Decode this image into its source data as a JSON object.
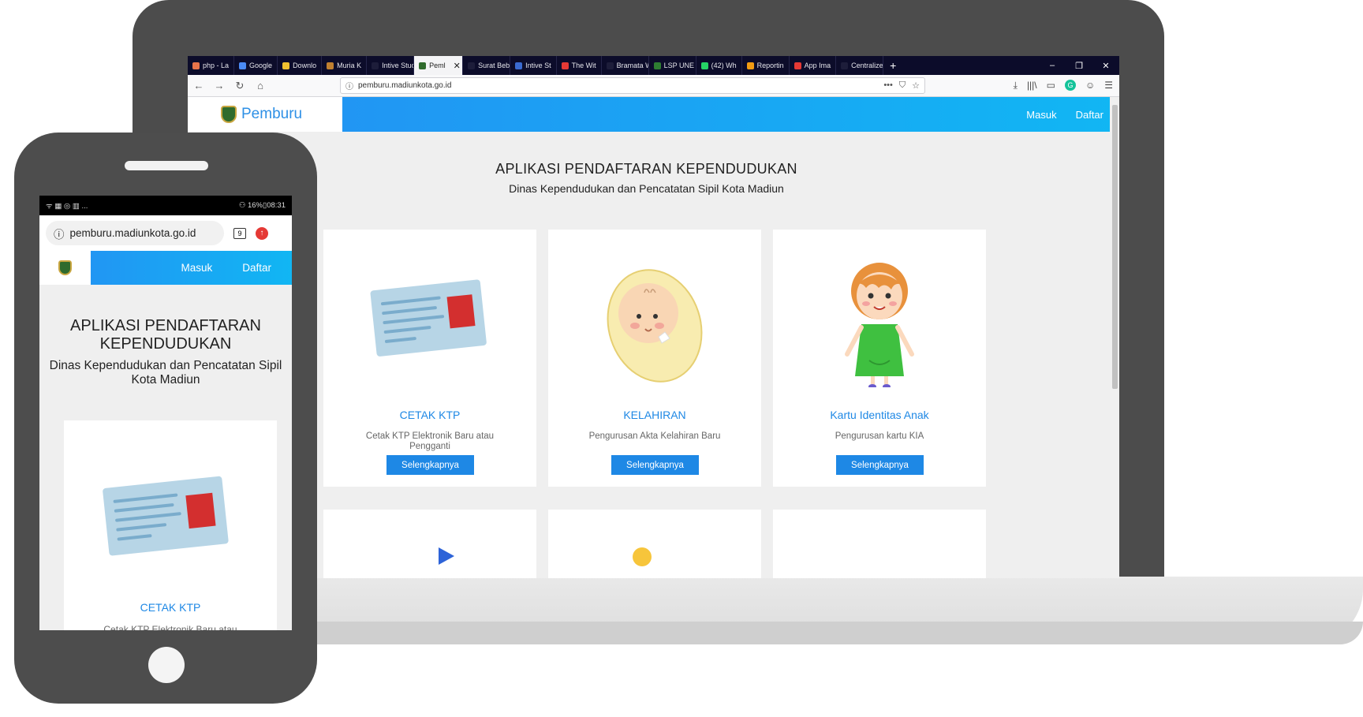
{
  "browser": {
    "tabs": [
      {
        "label": "php - La",
        "color": "#e8744a"
      },
      {
        "label": "Google",
        "color": "#4a8af4"
      },
      {
        "label": "Downlo",
        "color": "#f0c030"
      },
      {
        "label": "Muria K",
        "color": "#c08030"
      },
      {
        "label": "Intive Studio",
        "color": "#1d1d3a"
      },
      {
        "label": "Peml",
        "color": "#2f6b2d",
        "active": true
      },
      {
        "label": "Surat Bebas",
        "color": "#1d1d3a"
      },
      {
        "label": "Intive St",
        "color": "#3a6ad0"
      },
      {
        "label": "The Wit",
        "color": "#e53935"
      },
      {
        "label": "Bramata Wi",
        "color": "#1d1d3a"
      },
      {
        "label": "LSP UNE",
        "color": "#2e7d32"
      },
      {
        "label": "(42) Wh",
        "color": "#25d366"
      },
      {
        "label": "Reportin",
        "color": "#f39c12"
      },
      {
        "label": "App Ima",
        "color": "#e53935"
      },
      {
        "label": "Centralize H",
        "color": "#1d1d3a"
      }
    ],
    "new_tab": "+",
    "window_controls": [
      "–",
      "❐",
      "✕"
    ],
    "url": "pemburu.madiunkota.go.id",
    "url_actions": [
      "•••",
      "⛉",
      "☆"
    ],
    "toolbar_icons": [
      "⤓",
      "|||\\",
      "▭",
      "G",
      "☺",
      "☰"
    ],
    "nav_icons": [
      "←",
      "→",
      "↻",
      "⌂"
    ]
  },
  "site": {
    "brand": "Pemburu",
    "nav": {
      "login": "Masuk",
      "register": "Daftar"
    },
    "title": "APLIKASI PENDAFTARAN KEPENDUDUKAN",
    "subtitle": "Dinas Kependudukan dan Pencatatan Sipil Kota Madiun",
    "cards": [
      {
        "title": "CETAK KTP",
        "description": "Cetak KTP Elektronik Baru atau Pengganti",
        "button": "Selengkapnya",
        "icon": "id-card"
      },
      {
        "title": "KELAHIRAN",
        "description": "Pengurusan Akta Kelahiran Baru",
        "button": "Selengkapnya",
        "icon": "baby"
      },
      {
        "title": "Kartu Identitas Anak",
        "description": "Pengurusan kartu KIA",
        "button": "Selengkapnya",
        "icon": "child"
      }
    ]
  },
  "phone": {
    "status_left": "ᯤ ▦ ◎ ▥ ...",
    "status_right": "⚇ 16%▯08:31",
    "url": "pemburu.madiunkota.go.id",
    "tab_count": "9",
    "title": "APLIKASI PENDAFTARAN KEPENDUDUKAN",
    "subtitle": "Dinas Kependudukan dan Pencatatan Sipil Kota Madiun",
    "card_title": "CETAK KTP",
    "card_description": "Cetak KTP Elektronik Baru atau"
  }
}
